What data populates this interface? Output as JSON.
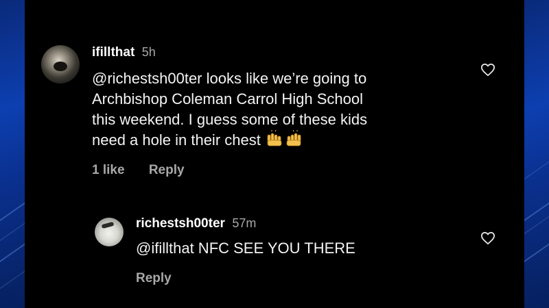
{
  "comments": [
    {
      "username": "ifillthat",
      "time": "5h",
      "lines": [
        "@richestsh00ter looks like we’re going to",
        "Archbishop Coleman Carrol High School",
        "this weekend. I guess some of these kids",
        "need a hole in their chest"
      ],
      "emoji": "raised-hands-emoji",
      "likes": "1 like",
      "reply_label": "Reply"
    },
    {
      "username": "richestsh00ter",
      "time": "57m",
      "text": "@ifillthat NFC SEE YOU THERE",
      "reply_label": "Reply"
    }
  ],
  "icons": {
    "like": "heart-outline-icon",
    "avatar": "user-avatar"
  },
  "colors": {
    "background": "#000000",
    "text": "#f4f4f4",
    "muted": "#a8a8a8",
    "side_bar": "#0d3fb0"
  }
}
